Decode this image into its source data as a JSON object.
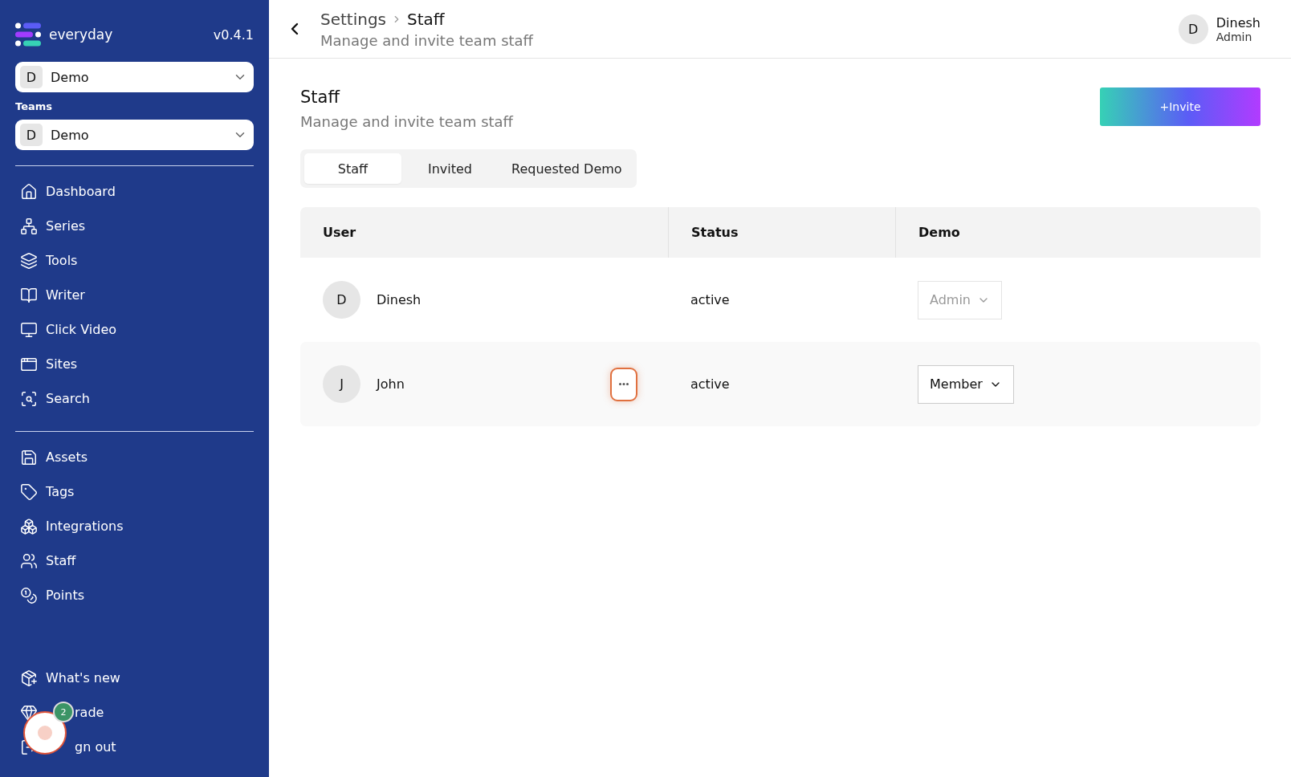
{
  "sidebar": {
    "brand": "everyday",
    "version": "v0.4.1",
    "workspace": {
      "initial": "D",
      "name": "Demo"
    },
    "teams_label": "Teams",
    "team": {
      "initial": "D",
      "name": "Demo"
    },
    "nav_groups": [
      [
        {
          "label": "Dashboard"
        },
        {
          "label": "Series"
        },
        {
          "label": "Tools"
        },
        {
          "label": "Writer"
        },
        {
          "label": "Click Video"
        },
        {
          "label": "Sites"
        },
        {
          "label": "Search"
        }
      ],
      [
        {
          "label": "Assets"
        },
        {
          "label": "Tags"
        },
        {
          "label": "Integrations"
        },
        {
          "label": "Staff"
        },
        {
          "label": "Points"
        }
      ]
    ],
    "bottom": [
      {
        "label": "What's new",
        "kind": "plain"
      },
      {
        "label": "rade",
        "kind": "covered"
      },
      {
        "label": "gn out",
        "kind": "covered"
      }
    ],
    "help_bubble": {
      "count": "2"
    }
  },
  "header": {
    "breadcrumb": [
      "Settings",
      "Staff"
    ],
    "subtitle": "Manage and invite team staff",
    "user": {
      "initial": "D",
      "name": "Dinesh",
      "role": "Admin"
    }
  },
  "page": {
    "title": "Staff",
    "subtitle": "Manage and invite team staff",
    "invite_button": "+Invite",
    "tabs": [
      {
        "label": "Staff",
        "selected": true
      },
      {
        "label": "Invited",
        "selected": false
      },
      {
        "label": "Requested Demo",
        "selected": false
      }
    ],
    "table": {
      "columns": [
        "User",
        "Status",
        "Demo"
      ],
      "rows": [
        {
          "initial": "D",
          "name": "Dinesh",
          "status": "active",
          "role": "Admin",
          "role_disabled": true,
          "hovered": false
        },
        {
          "initial": "J",
          "name": "John",
          "status": "active",
          "role": "Member",
          "role_disabled": false,
          "hovered": true
        }
      ]
    }
  }
}
